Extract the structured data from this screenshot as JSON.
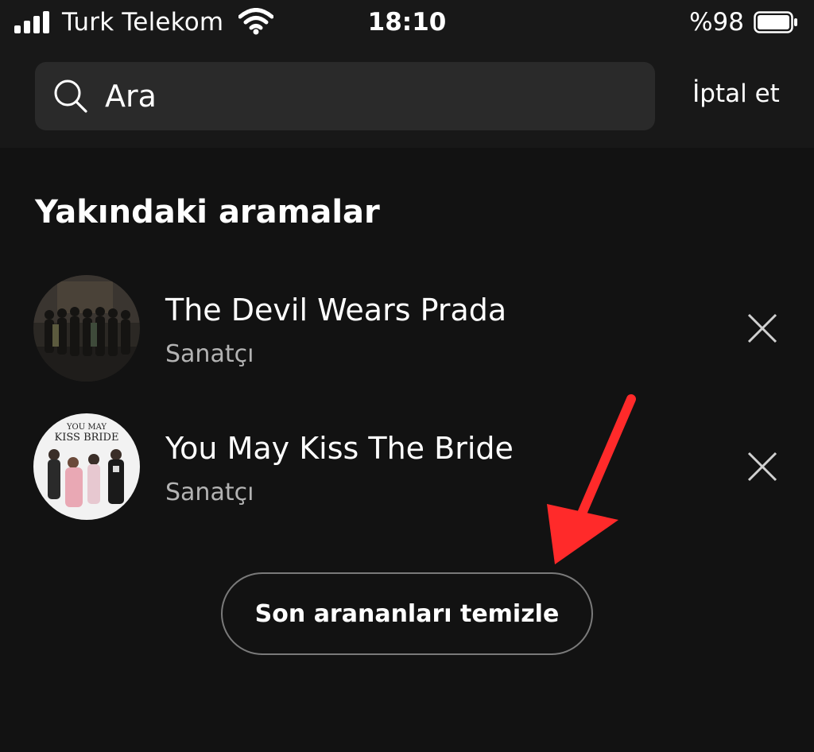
{
  "status_bar": {
    "carrier": "Turk Telekom",
    "time": "18:10",
    "battery_percent": "%98",
    "signal_bars": 4,
    "icons": [
      "signal-icon",
      "wifi-icon",
      "battery-icon"
    ]
  },
  "search": {
    "placeholder": "Ara",
    "value": "",
    "icon": "search-icon",
    "cancel_label": "İptal et"
  },
  "recent": {
    "title": "Yakındaki aramalar",
    "items": [
      {
        "title": "The Devil Wears Prada",
        "subtitle": "Sanatçı",
        "avatar": "band-photo-avatar",
        "remove_icon": "close-icon"
      },
      {
        "title": "You May Kiss The Bride",
        "subtitle": "Sanatçı",
        "avatar": "band-photo-avatar",
        "remove_icon": "close-icon"
      }
    ],
    "clear_label": "Son arananları temizle"
  },
  "annotation": {
    "type": "arrow",
    "color": "#ff2a2a",
    "points_to": "clear-recent-button"
  },
  "colors": {
    "background": "#121212",
    "header": "#181818",
    "search_box": "#2a2a2a",
    "secondary_text": "#b3b3b3"
  }
}
